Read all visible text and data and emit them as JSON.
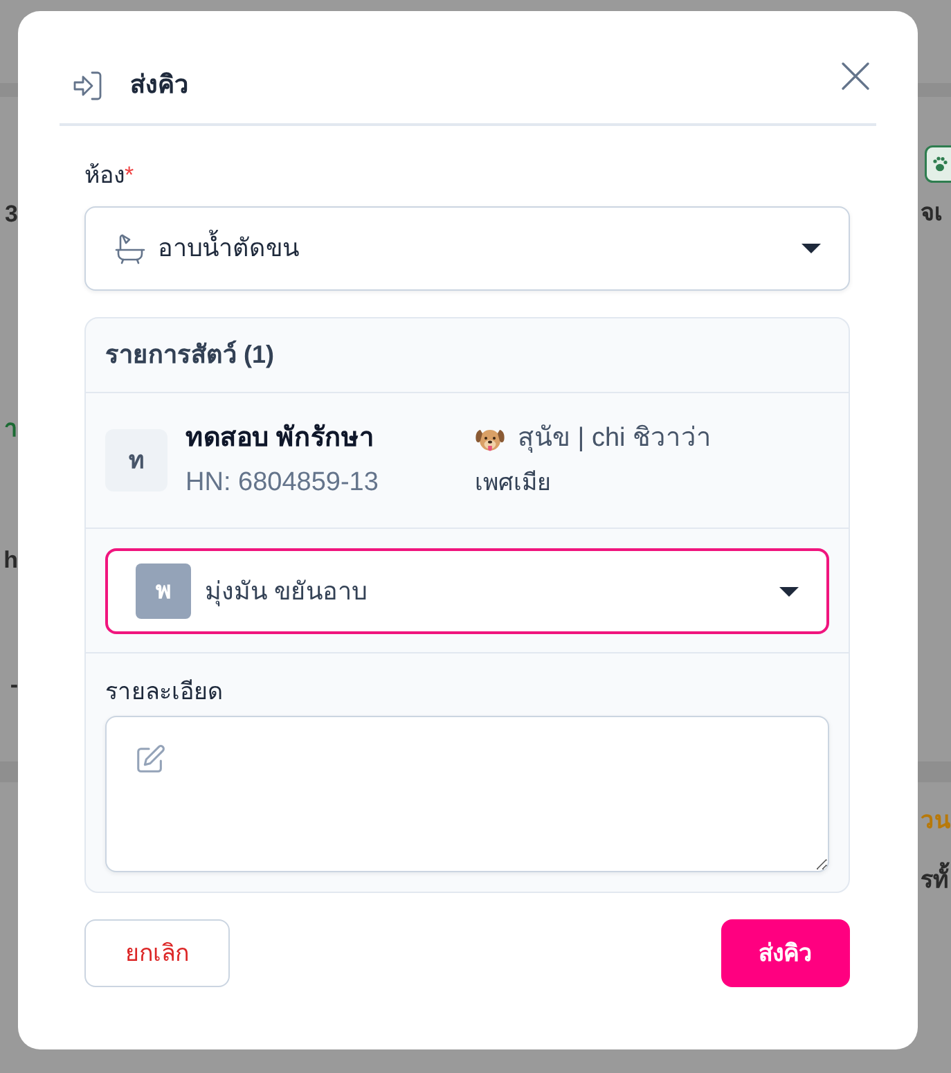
{
  "background": {
    "left_edge": [
      {
        "kind": "text",
        "text": "3",
        "color": "#2b2b2b"
      },
      {
        "kind": "text",
        "text": "า",
        "color": "#1c6b34"
      },
      {
        "kind": "text",
        "text": "h",
        "color": "#2b2b2b"
      },
      {
        "kind": "text",
        "text": "-",
        "color": "#2b2b2b"
      }
    ],
    "right_edge": [
      {
        "kind": "badge",
        "color": "#2e7d4f"
      },
      {
        "kind": "text",
        "text": "จเ",
        "color": "#2b2b2b"
      },
      {
        "kind": "text",
        "text": "วน",
        "color": "#b8790a"
      },
      {
        "kind": "text",
        "text": "รทั้",
        "color": "#2b2b2b"
      }
    ]
  },
  "dialog": {
    "title": "ส่งคิว"
  },
  "room_field": {
    "label": "ห้อง",
    "required_mark": "*",
    "value": "อาบน้ำตัดขน"
  },
  "pet_list": {
    "title": "รายการสัตว์ (1)",
    "pets": [
      {
        "initial": "ท",
        "name": "ทดสอบ พักรักษา",
        "hn": "HN: 6804859-13",
        "species": "สุนัข | chi ชิวาว่า",
        "sex": "เพศเมีย",
        "staff_select": {
          "initial": "พ",
          "value": "มุ่งมัน ขยันอาบ",
          "highlighted": true
        },
        "details": {
          "label": "รายละเอียด"
        }
      }
    ]
  },
  "buttons": [
    {
      "kind": "cancel",
      "label": "ยกเลิก"
    },
    {
      "kind": "submit",
      "label": "ส่งคิว"
    }
  ]
}
